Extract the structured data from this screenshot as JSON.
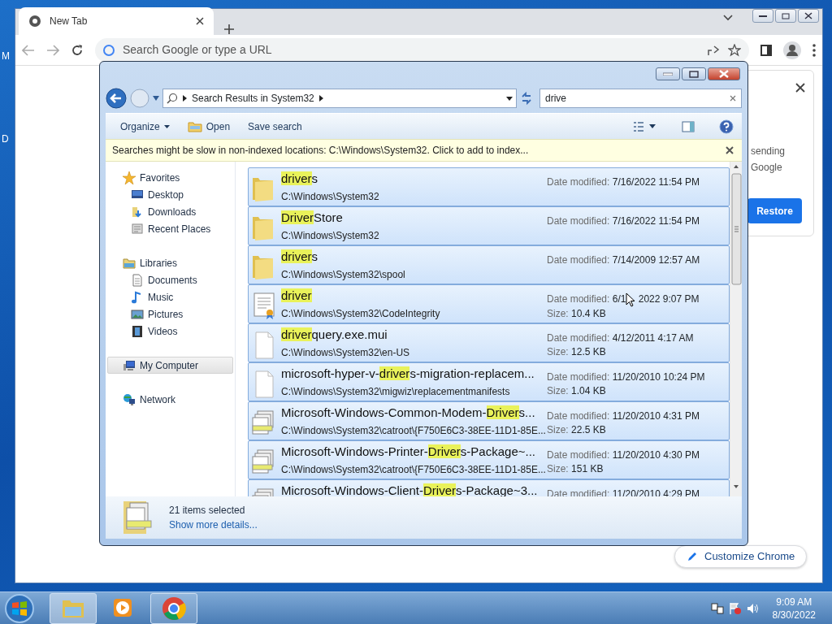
{
  "desktop": {
    "edge_labels": [
      "M",
      "D"
    ]
  },
  "browser": {
    "tab": {
      "title": "New Tab",
      "selected": true
    },
    "omnibox": {
      "placeholder": "Search Google or type a URL"
    },
    "side_panel": {
      "lines": [
        "sending",
        "Google"
      ],
      "button": "Restore"
    },
    "customize_button": "Customize Chrome"
  },
  "explorer": {
    "breadcrumb": "Search Results in System32",
    "search": {
      "value": "drive"
    },
    "toolbar": [
      "Organize",
      "Open",
      "Save search"
    ],
    "infobar": "Searches might be slow in non-indexed locations: C:\\Windows\\System32. Click to add to index...",
    "sidebar": [
      {
        "label": "Favorites",
        "selected": false,
        "children": [
          {
            "label": "Desktop",
            "selected": false
          },
          {
            "label": "Downloads",
            "selected": false
          },
          {
            "label": "Recent Places",
            "selected": false
          }
        ]
      },
      {
        "label": "Libraries",
        "selected": false,
        "children": [
          {
            "label": "Documents",
            "selected": false
          },
          {
            "label": "Music",
            "selected": false
          },
          {
            "label": "Pictures",
            "selected": false
          },
          {
            "label": "Videos",
            "selected": false
          }
        ]
      },
      {
        "label": "My Computer",
        "selected": true
      },
      {
        "label": "Network",
        "selected": false
      }
    ],
    "results": [
      {
        "kind": "folder",
        "selected": true,
        "name_parts": [
          {
            "text": "driver",
            "highlighted": true
          },
          {
            "text": "s",
            "highlighted": false
          }
        ],
        "path": "C:\\Windows\\System32",
        "date_label": "Date modified:",
        "date": "7/16/2022 11:54 PM"
      },
      {
        "kind": "folder",
        "selected": true,
        "name_parts": [
          {
            "text": "Driver",
            "highlighted": true
          },
          {
            "text": "Store",
            "highlighted": false
          }
        ],
        "path": "C:\\Windows\\System32",
        "date_label": "Date modified:",
        "date": "7/16/2022 11:54 PM"
      },
      {
        "kind": "folder",
        "selected": true,
        "name_parts": [
          {
            "text": "driver",
            "highlighted": true
          },
          {
            "text": "s",
            "highlighted": false
          }
        ],
        "path": "C:\\Windows\\System32\\spool",
        "date_label": "Date modified:",
        "date": "7/14/2009 12:57 AM"
      },
      {
        "kind": "certificate",
        "selected": true,
        "name_parts": [
          {
            "text": "driver",
            "highlighted": true
          }
        ],
        "path": "C:\\Windows\\System32\\CodeIntegrity",
        "date_label": "Date modified:",
        "date": "6/1",
        "date_tail": "2022 9:07 PM",
        "size_label": "Size:",
        "size": "10.4 KB"
      },
      {
        "kind": "file",
        "selected": true,
        "name_parts": [
          {
            "text": "driver",
            "highlighted": true
          },
          {
            "text": "query.exe.mui",
            "highlighted": false
          }
        ],
        "path": "C:\\Windows\\System32\\en-US",
        "date_label": "Date modified:",
        "date": "4/12/2011 4:17 AM",
        "size_label": "Size:",
        "size": "12.5 KB"
      },
      {
        "kind": "file",
        "selected": true,
        "name_parts": [
          {
            "text": "microsoft-hyper-v-",
            "highlighted": false
          },
          {
            "text": "driver",
            "highlighted": true
          },
          {
            "text": "s-migration-replacem...",
            "highlighted": false
          }
        ],
        "path": "C:\\Windows\\System32\\migwiz\\replacementmanifests",
        "date_label": "Date modified:",
        "date": "11/20/2010 10:24 PM",
        "size_label": "Size:",
        "size": "1.04 KB"
      },
      {
        "kind": "catalog",
        "selected": true,
        "name_parts": [
          {
            "text": "Microsoft-Windows-Common-Modem-",
            "highlighted": false
          },
          {
            "text": "Driver",
            "highlighted": true
          },
          {
            "text": "s...",
            "highlighted": false
          }
        ],
        "path": "C:\\Windows\\System32\\catroot\\{F750E6C3-38EE-11D1-85E...",
        "date_label": "Date modified:",
        "date": "11/20/2010 4:31 PM",
        "size_label": "Size:",
        "size": "22.5 KB"
      },
      {
        "kind": "catalog",
        "selected": true,
        "name_parts": [
          {
            "text": "Microsoft-Windows-Printer-",
            "highlighted": false
          },
          {
            "text": "Driver",
            "highlighted": true
          },
          {
            "text": "s-Package~...",
            "highlighted": false
          }
        ],
        "path": "C:\\Windows\\System32\\catroot\\{F750E6C3-38EE-11D1-85E...",
        "date_label": "Date modified:",
        "date": "11/20/2010 4:30 PM",
        "size_label": "Size:",
        "size": "151 KB"
      },
      {
        "kind": "catalog",
        "selected": true,
        "name_parts": [
          {
            "text": "Microsoft-Windows-Client-",
            "highlighted": false
          },
          {
            "text": "Driver",
            "highlighted": true
          },
          {
            "text": "s-Package~3...",
            "highlighted": false
          }
        ],
        "date_label": "Date modified:",
        "date": "11/20/2010 4:29 PM"
      }
    ],
    "details": {
      "count": "21 items selected",
      "link": "Show more details..."
    }
  },
  "taskbar": {
    "apps": [
      {
        "kind": "explorer",
        "open": true,
        "selected": true
      },
      {
        "kind": "media",
        "open": false,
        "selected": false
      },
      {
        "kind": "chrome",
        "open": true,
        "selected": false
      }
    ],
    "time": "9:09 AM",
    "date": "8/30/2022"
  }
}
